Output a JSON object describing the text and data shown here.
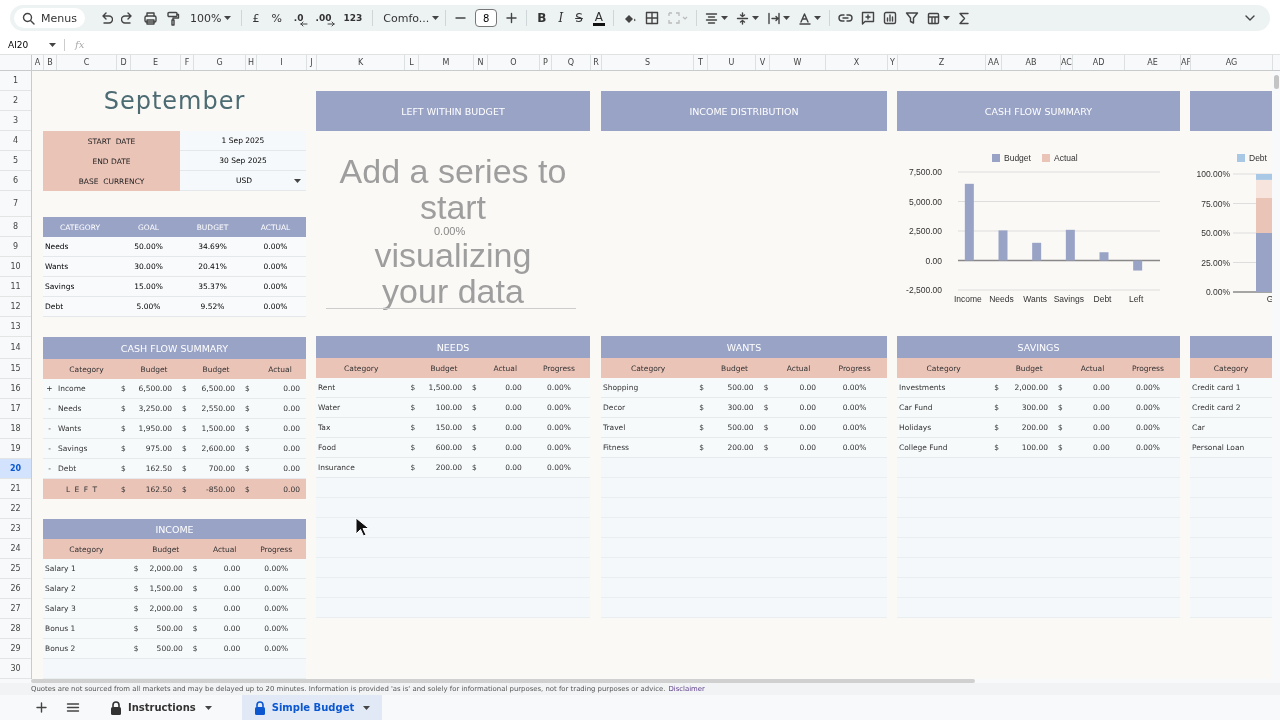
{
  "toolbar": {
    "search": "Menus",
    "zoom": "100%",
    "currency": "£",
    "percent": "%",
    "decrease_decimals": ".0",
    "increase_decimals": ".00",
    "more_formats": "123",
    "font": "Comfo...",
    "font_size": "8",
    "bold": "B",
    "italic": "I",
    "strikethrough": "S",
    "text_color": "A"
  },
  "name_box": "AI20",
  "formula_label": "fx",
  "columns": [
    "A",
    "B",
    "C",
    "D",
    "E",
    "F",
    "G",
    "H",
    "I",
    "J",
    "K",
    "L",
    "M",
    "N",
    "O",
    "P",
    "Q",
    "R",
    "S",
    "T",
    "U",
    "V",
    "W",
    "X",
    "Y",
    "Z",
    "AA",
    "AB",
    "AC",
    "AD",
    "AE",
    "AF",
    "AG"
  ],
  "rows": [
    {
      "label": "1",
      "selected": false
    },
    {
      "label": "2",
      "selected": false
    },
    {
      "label": "3",
      "selected": false
    },
    {
      "label": "4",
      "selected": false
    },
    {
      "label": "5",
      "selected": false
    },
    {
      "label": "6",
      "selected": false
    },
    {
      "label": "7",
      "selected": false
    },
    {
      "label": "8",
      "selected": false
    },
    {
      "label": "9",
      "selected": false
    },
    {
      "label": "10",
      "selected": false
    },
    {
      "label": "11",
      "selected": false
    },
    {
      "label": "12",
      "selected": false
    },
    {
      "label": "13",
      "selected": false
    },
    {
      "label": "14",
      "selected": false
    },
    {
      "label": "15",
      "selected": false
    },
    {
      "label": "16",
      "selected": false
    },
    {
      "label": "17",
      "selected": false
    },
    {
      "label": "18",
      "selected": false
    },
    {
      "label": "19",
      "selected": false
    },
    {
      "label": "20",
      "selected": true
    },
    {
      "label": "21",
      "selected": false
    },
    {
      "label": "22",
      "selected": false
    },
    {
      "label": "23",
      "selected": false
    },
    {
      "label": "24",
      "selected": false
    },
    {
      "label": "25",
      "selected": false
    },
    {
      "label": "26",
      "selected": false
    },
    {
      "label": "27",
      "selected": false
    },
    {
      "label": "28",
      "selected": false
    },
    {
      "label": "29",
      "selected": false
    },
    {
      "label": "30",
      "selected": false
    }
  ],
  "month_title": "September",
  "settings": [
    {
      "label": "START  DATE",
      "value": "1 Sep 2025",
      "kind": "text"
    },
    {
      "label": "END DATE",
      "value": "30 Sep 2025",
      "kind": "text"
    },
    {
      "label": "BASE  CURRENCY",
      "value": "USD",
      "kind": "dropdown"
    }
  ],
  "allocation": {
    "columns": [
      "CATEGORY",
      "GOAL",
      "BUDGET",
      "ACTUAL"
    ],
    "rows": [
      [
        "Needs",
        "50.00%",
        "34.69%",
        "0.00%"
      ],
      [
        "Wants",
        "30.00%",
        "20.41%",
        "0.00%"
      ],
      [
        "Savings",
        "15.00%",
        "35.37%",
        "0.00%"
      ],
      [
        "Debt",
        "5.00%",
        "9.52%",
        "0.00%"
      ]
    ]
  },
  "cash_flow": {
    "title": "CASH FLOW SUMMARY",
    "columns": [
      "",
      "Category",
      "",
      "Budget",
      "",
      "Budget",
      "",
      "Actual"
    ],
    "rows": [
      {
        "kind": "line",
        "cells": [
          "+",
          "Income",
          "$",
          "6,500.00",
          "$",
          "6,500.00",
          "$",
          "0.00"
        ]
      },
      {
        "kind": "line",
        "cells": [
          "-",
          "Needs",
          "$",
          "3,250.00",
          "$",
          "2,550.00",
          "$",
          "0.00"
        ]
      },
      {
        "kind": "line",
        "cells": [
          "-",
          "Wants",
          "$",
          "1,950.00",
          "$",
          "1,500.00",
          "$",
          "0.00"
        ]
      },
      {
        "kind": "line",
        "cells": [
          "-",
          "Savings",
          "$",
          "975.00",
          "$",
          "2,600.00",
          "$",
          "0.00"
        ]
      },
      {
        "kind": "line",
        "cells": [
          "-",
          "Debt",
          "$",
          "162.50",
          "$",
          "700.00",
          "$",
          "0.00"
        ]
      },
      {
        "kind": "total",
        "cells": [
          "",
          "L E F T",
          "$",
          "162.50",
          "$",
          "-850.00",
          "$",
          "0.00"
        ]
      }
    ]
  },
  "income": {
    "title": "INCOME",
    "columns": [
      "Category",
      "",
      "Budget",
      "",
      "Actual",
      "Progress"
    ],
    "rows": [
      [
        "Salary 1",
        "$",
        "2,000.00",
        "$",
        "0.00",
        "0.00%"
      ],
      [
        "Salary 2",
        "$",
        "1,500.00",
        "$",
        "0.00",
        "0.00%"
      ],
      [
        "Salary 3",
        "$",
        "2,000.00",
        "$",
        "0.00",
        "0.00%"
      ],
      [
        "Bonus 1",
        "$",
        "500.00",
        "$",
        "0.00",
        "0.00%"
      ],
      [
        "Bonus 2",
        "$",
        "500.00",
        "$",
        "0.00",
        "0.00%"
      ]
    ]
  },
  "sections": [
    {
      "panel": {
        "title": "LEFT WITHIN BUDGET",
        "kind": "empty_chart",
        "placeholder_lines": [
          "Add a series to start",
          "visualizing your data"
        ],
        "value": "0.00%"
      },
      "table": {
        "title": "NEEDS",
        "columns": [
          "Category",
          "",
          "Budget",
          "",
          "Actual",
          "Progress"
        ],
        "rows": [
          [
            "Rent",
            "$",
            "1,500.00",
            "$",
            "0.00",
            "0.00%"
          ],
          [
            "Water",
            "$",
            "100.00",
            "$",
            "0.00",
            "0.00%"
          ],
          [
            "Tax",
            "$",
            "150.00",
            "$",
            "0.00",
            "0.00%"
          ],
          [
            "Food",
            "$",
            "600.00",
            "$",
            "0.00",
            "0.00%"
          ],
          [
            "Insurance",
            "$",
            "200.00",
            "$",
            "0.00",
            "0.00%"
          ]
        ]
      }
    },
    {
      "panel": {
        "title": "INCOME DISTRIBUTION",
        "kind": "blank"
      },
      "table": {
        "title": "WANTS",
        "columns": [
          "Category",
          "",
          "Budget",
          "",
          "Actual",
          "Progress"
        ],
        "rows": [
          [
            "Shopping",
            "$",
            "500.00",
            "$",
            "0.00",
            "0.00%"
          ],
          [
            "Decor",
            "$",
            "300.00",
            "$",
            "0.00",
            "0.00%"
          ],
          [
            "Travel",
            "$",
            "500.00",
            "$",
            "0.00",
            "0.00%"
          ],
          [
            "Fitness",
            "$",
            "200.00",
            "$",
            "0.00",
            "0.00%"
          ]
        ]
      }
    },
    {
      "panel": {
        "title": "CASH FLOW SUMMARY",
        "kind": "chart",
        "chart_data": {
          "type": "bar",
          "grid": true,
          "categories": [
            "Income",
            "Needs",
            "Wants",
            "Savings",
            "Debt",
            "Left"
          ],
          "series": [
            {
              "name": "Budget",
              "color": "#99a3c6",
              "values": [
                6500,
                2550,
                1500,
                2600,
                700,
                -850
              ]
            },
            {
              "name": "Actual",
              "color": "#ebc4b8",
              "values": [
                0,
                0,
                0,
                0,
                0,
                0
              ]
            }
          ],
          "ylim": [
            -2500,
            7500
          ],
          "yticks": [
            {
              "value": -2500,
              "label": "-2,500.00"
            },
            {
              "value": 0,
              "label": "0.00"
            },
            {
              "value": 2500,
              "label": "2,500.00"
            },
            {
              "value": 5000,
              "label": "5,000.00"
            },
            {
              "value": 7500,
              "label": "7,500.00"
            }
          ]
        }
      },
      "table": {
        "title": "SAVINGS",
        "columns": [
          "Category",
          "",
          "Budget",
          "",
          "Actual",
          "Progress"
        ],
        "rows": [
          [
            "Investments",
            "$",
            "2,000.00",
            "$",
            "0.00",
            "0.00%"
          ],
          [
            "Car Fund",
            "$",
            "300.00",
            "$",
            "0.00",
            "0.00%"
          ],
          [
            "Holidays",
            "$",
            "200.00",
            "$",
            "0.00",
            "0.00%"
          ],
          [
            "College Fund",
            "$",
            "100.00",
            "$",
            "0.00",
            "0.00%"
          ]
        ]
      }
    },
    {
      "panel": {
        "kind": "chart",
        "chart_data": {
          "type": "bar",
          "stacked": true,
          "grid": true,
          "categories": [
            "G"
          ],
          "series": [
            {
              "color": "#99a3c6",
              "values": [
                50
              ]
            },
            {
              "color": "#ebc4b8",
              "values": [
                30
              ]
            },
            {
              "color": "#f7e4dd",
              "values": [
                15
              ]
            },
            {
              "name": "Debt",
              "color": "#a9c8e6",
              "values": [
                5
              ]
            }
          ],
          "ylim": [
            0,
            100
          ],
          "yticks": [
            {
              "value": 0,
              "label": "0.00%"
            },
            {
              "value": 25,
              "label": "25.00%"
            },
            {
              "value": 50,
              "label": "50.00%"
            },
            {
              "value": 75,
              "label": "75.00%"
            },
            {
              "value": 100,
              "label": "100.00%"
            }
          ]
        }
      },
      "table": {
        "columns": [
          "Category"
        ],
        "rows": [
          [
            "Credit card 1"
          ],
          [
            "Credit card 2"
          ],
          [
            "Car"
          ],
          [
            "Personal Loan"
          ]
        ]
      }
    }
  ],
  "notice": {
    "text": "Quotes are not sourced from all markets and may be delayed up to 20 minutes. Information is provided 'as is' and solely for informational purposes, not for trading purposes or advice.",
    "link": "Disclaimer"
  },
  "sheet_tabs": [
    {
      "label": "Instructions",
      "locked": true,
      "selected": false
    },
    {
      "label": "Simple Budget",
      "locked": true,
      "selected": true
    }
  ]
}
